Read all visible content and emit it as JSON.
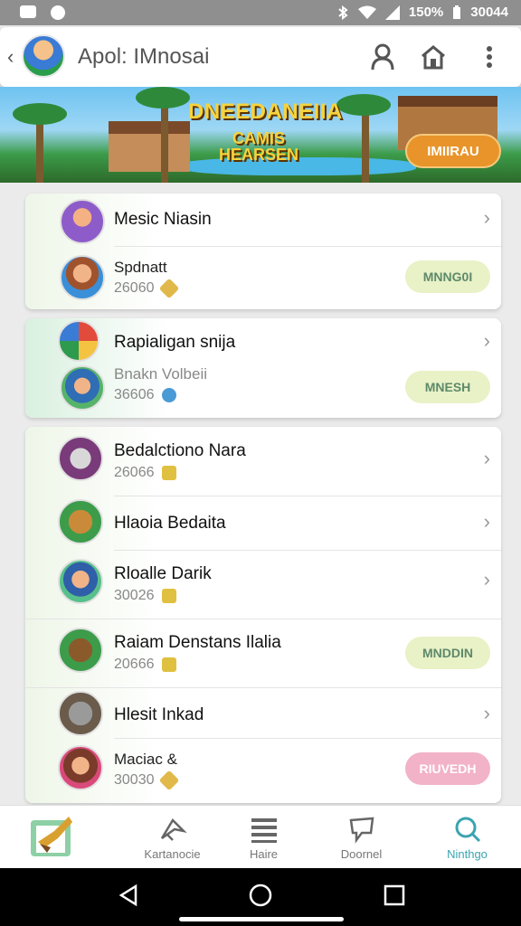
{
  "status_bar": {
    "battery": "150%",
    "time": "30044"
  },
  "header": {
    "title": "Apol: IMnosai"
  },
  "banner": {
    "title": "DNEEDANEIIA",
    "subtitle_1": "CAMIS",
    "subtitle_2": "HEARSEN",
    "cta_label": "IMIIRAU"
  },
  "cards": [
    {
      "rows": [
        {
          "title": "Mesic Niasin"
        },
        {
          "title": "Spdnatt",
          "count": "26060",
          "button": "MNNG0I"
        }
      ]
    },
    {
      "rows": [
        {
          "title": "Rapialigan snija"
        },
        {
          "title": "Bnakn Volbeii",
          "count": "36606",
          "button": "MNESH"
        }
      ]
    },
    {
      "rows": [
        {
          "title": "Bedalctiono Nara",
          "count": "26066"
        },
        {
          "title": "Hlaoia Bedaita"
        },
        {
          "title": "Rloalle Darik",
          "count": "30026"
        },
        {
          "title": "Raiam Denstans Ilalia",
          "count": "20666",
          "button": "MNDDIN"
        },
        {
          "title": "Hlesit Inkad"
        },
        {
          "title": "Maciac &",
          "count": "30030",
          "button": "RIUVEDH"
        }
      ]
    }
  ],
  "colors": {
    "pill_green": "#e9f1c7",
    "pill_green_text": "#5d8a6a",
    "pill_pink": "#f2b2c8",
    "pill_pink_text": "#ffffff",
    "accent": "#3aa4b0",
    "banner_cta": "#e8942a"
  },
  "bottom_nav": [
    {
      "label": "",
      "icon": "game-home-icon"
    },
    {
      "label": "Kartanocie",
      "icon": "send-icon"
    },
    {
      "label": "Haire",
      "icon": "list-icon"
    },
    {
      "label": "Doornel",
      "icon": "chat-bubble-icon"
    },
    {
      "label": "Ninthgo",
      "icon": "search-icon"
    }
  ]
}
